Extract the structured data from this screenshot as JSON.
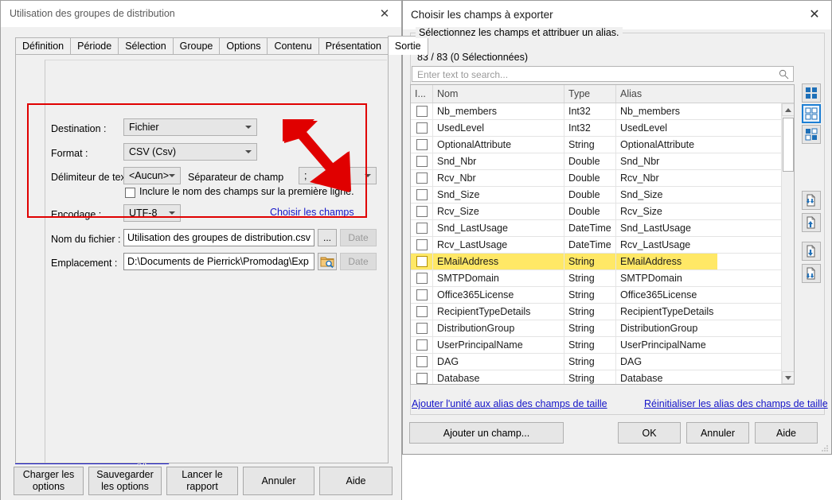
{
  "left_window": {
    "title": "Utilisation des groupes de distribution",
    "close_label": "✕",
    "tabs": [
      {
        "label": "Définition",
        "active": false
      },
      {
        "label": "Période",
        "active": false
      },
      {
        "label": "Sélection",
        "active": false
      },
      {
        "label": "Groupe",
        "active": false
      },
      {
        "label": "Options",
        "active": false
      },
      {
        "label": "Contenu",
        "active": false
      },
      {
        "label": "Présentation",
        "active": false
      },
      {
        "label": "Sortie",
        "active": true
      }
    ],
    "form": {
      "destination_label": "Destination :",
      "destination_value": "Fichier",
      "format_label": "Format :",
      "format_value": "CSV (Csv)",
      "text_delimiter_label": "Délimiteur de texte",
      "text_delimiter_value": "<Aucun>",
      "field_separator_label": "Séparateur de champ",
      "field_separator_value": ";",
      "include_header_label": "Inclure le nom des champs sur la première ligne.",
      "encoding_label": "Encodage :",
      "encoding_value": "UTF-8",
      "choose_fields_link": "Choisir les champs",
      "filename_label": "Nom du fichier :",
      "filename_value": "Utilisation des groupes de distribution.csv",
      "browse_label": "...",
      "date_label_1": "Date",
      "location_label": "Emplacement :",
      "location_value": "D:\\Documents de Pierrick\\Promodag\\Exp",
      "date_label_2": "Date"
    },
    "automate_link": "Comment automatiser ce rapport ?",
    "buttons": [
      {
        "line1": "Charger les",
        "line2": "options"
      },
      {
        "line1": "Sauvegarder",
        "line2": "les options"
      },
      {
        "line1": "Lancer  le",
        "line2": "rapport"
      },
      {
        "line1": "Annuler",
        "line2": ""
      },
      {
        "line1": "Aide",
        "line2": ""
      }
    ]
  },
  "right_dialog": {
    "title": "Choisir les champs à exporter",
    "close_label": "✕",
    "group_title": "Sélectionnez les champs et attribuer un alias.",
    "count_text": "83 / 83 (0 Sélectionnées)",
    "search_placeholder": "Enter text to search...",
    "columns": [
      "I...",
      "Nom",
      "Type",
      "Alias"
    ],
    "rows": [
      {
        "name": "Nb_members",
        "type": "Int32",
        "alias": "Nb_members",
        "checked": false,
        "highlight": false
      },
      {
        "name": "UsedLevel",
        "type": "Int32",
        "alias": "UsedLevel",
        "checked": false,
        "highlight": false
      },
      {
        "name": "OptionalAttribute",
        "type": "String",
        "alias": "OptionalAttribute",
        "checked": false,
        "highlight": false
      },
      {
        "name": "Snd_Nbr",
        "type": "Double",
        "alias": "Snd_Nbr",
        "checked": false,
        "highlight": false
      },
      {
        "name": "Rcv_Nbr",
        "type": "Double",
        "alias": "Rcv_Nbr",
        "checked": false,
        "highlight": false
      },
      {
        "name": "Snd_Size",
        "type": "Double",
        "alias": "Snd_Size",
        "checked": false,
        "highlight": false
      },
      {
        "name": "Rcv_Size",
        "type": "Double",
        "alias": "Rcv_Size",
        "checked": false,
        "highlight": false
      },
      {
        "name": "Snd_LastUsage",
        "type": "DateTime",
        "alias": "Snd_LastUsage",
        "checked": false,
        "highlight": false
      },
      {
        "name": "Rcv_LastUsage",
        "type": "DateTime",
        "alias": "Rcv_LastUsage",
        "checked": false,
        "highlight": false
      },
      {
        "name": "EMailAddress",
        "type": "String",
        "alias": "EMailAddress",
        "checked": false,
        "highlight": true
      },
      {
        "name": "SMTPDomain",
        "type": "String",
        "alias": "SMTPDomain",
        "checked": false,
        "highlight": false
      },
      {
        "name": "Office365License",
        "type": "String",
        "alias": "Office365License",
        "checked": false,
        "highlight": false
      },
      {
        "name": "RecipientTypeDetails",
        "type": "String",
        "alias": "RecipientTypeDetails",
        "checked": false,
        "highlight": false
      },
      {
        "name": "DistributionGroup",
        "type": "String",
        "alias": "DistributionGroup",
        "checked": false,
        "highlight": false
      },
      {
        "name": "UserPrincipalName",
        "type": "String",
        "alias": "UserPrincipalName",
        "checked": false,
        "highlight": false
      },
      {
        "name": "DAG",
        "type": "String",
        "alias": "DAG",
        "checked": false,
        "highlight": false
      },
      {
        "name": "Database",
        "type": "String",
        "alias": "Database",
        "checked": false,
        "highlight": false
      }
    ],
    "link_add_unit": "Ajouter l'unité aux alias des champs de taille",
    "link_reset_alias": "Réinitialiser les alias des champs de taille",
    "btn_add_field": "Ajouter un champ...",
    "btn_ok": "OK",
    "btn_cancel": "Annuler",
    "btn_help": "Aide",
    "toolbar_icons": [
      {
        "name": "select-all-icon"
      },
      {
        "name": "deselect-all-icon"
      },
      {
        "name": "invert-selection-icon"
      },
      {
        "name": "move-to-top-icon"
      },
      {
        "name": "move-up-icon"
      },
      {
        "name": "move-down-icon"
      },
      {
        "name": "move-to-bottom-icon"
      }
    ]
  },
  "colors": {
    "highlight_row": "#ffe866",
    "link": "#1414c8",
    "arrow": "#e00000",
    "accent_blue": "#1d7fd4",
    "window_bg": "#f0f0f0"
  }
}
